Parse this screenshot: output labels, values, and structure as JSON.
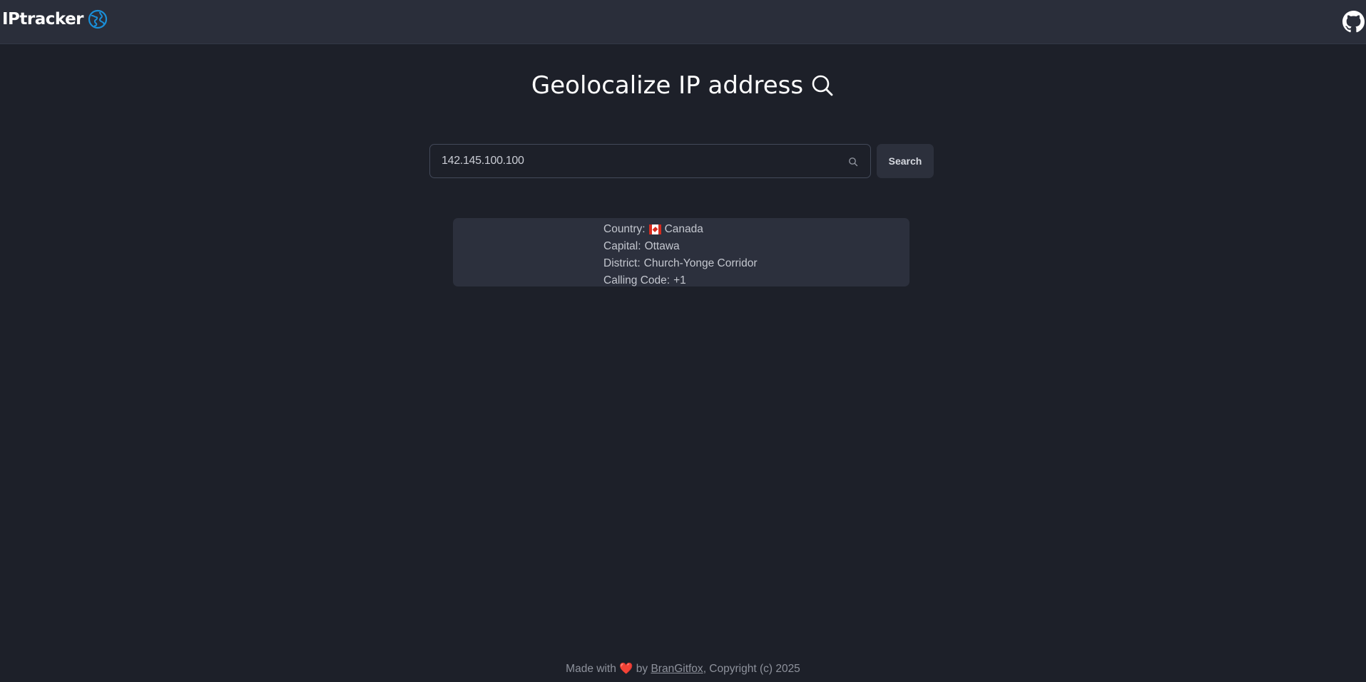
{
  "header": {
    "brand": "IPtracker",
    "brand_icon": "globe-icon",
    "github_icon": "github-icon"
  },
  "main": {
    "title": "Geolocalize IP address",
    "title_icon": "search-icon"
  },
  "search": {
    "value": "142.145.100.100",
    "button_label": "Search"
  },
  "result": {
    "country_label": "Country:",
    "country_value": "Canada",
    "country_flag": "canada-flag-icon",
    "capital_label": "Capital:",
    "capital_value": "Ottawa",
    "district_label": "District:",
    "district_value": "Church-Yonge Corridor",
    "calling_label": "Calling Code:",
    "calling_value": "+1"
  },
  "footer": {
    "made_with": "Made with",
    "heart": "❤️",
    "by": "by",
    "author": "BranGitfox",
    "copyright": ", Copyright (c) 2025"
  },
  "colors": {
    "background": "#1d2029",
    "navbar": "#2a2e3a",
    "card": "#2c303d",
    "accent_globe": "#1a8fd8",
    "heart": "#e0192a"
  }
}
